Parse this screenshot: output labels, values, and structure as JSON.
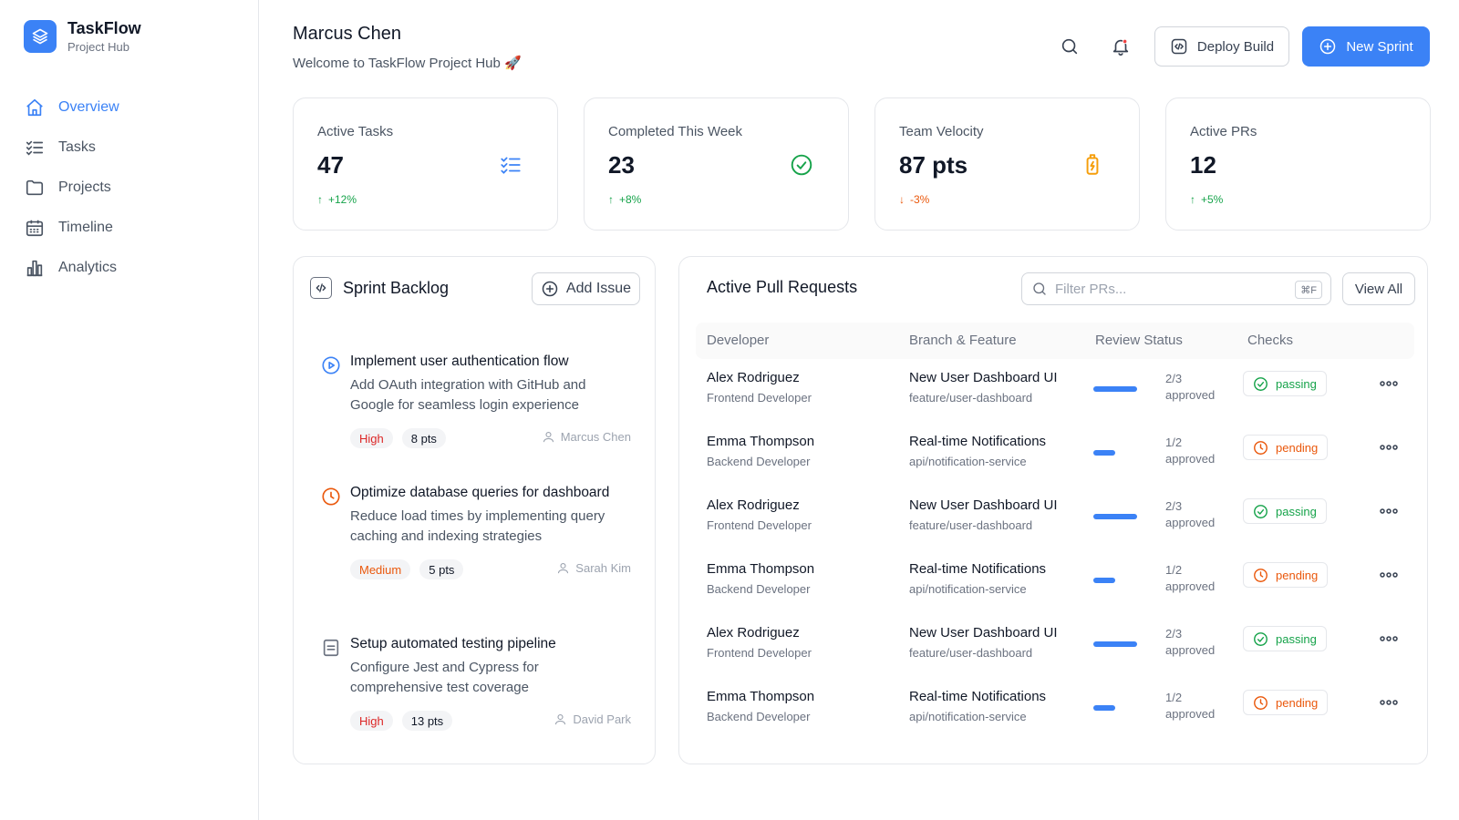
{
  "sidebar": {
    "brand_name": "TaskFlow",
    "brand_sub": "Project Hub",
    "items": [
      {
        "label": "Overview",
        "icon": "home-icon",
        "active": true
      },
      {
        "label": "Tasks",
        "icon": "list-check-icon"
      },
      {
        "label": "Projects",
        "icon": "folder-icon"
      },
      {
        "label": "Timeline",
        "icon": "calendar-icon"
      },
      {
        "label": "Analytics",
        "icon": "bar-chart-icon"
      }
    ]
  },
  "header": {
    "user_name": "Marcus Chen",
    "welcome": "Welcome to TaskFlow Project Hub 🚀",
    "deploy_label": "Deploy Build",
    "new_sprint_label": "New Sprint"
  },
  "stats": [
    {
      "label": "Active Tasks",
      "value": "47",
      "trend": "+12%",
      "direction": "up",
      "icon": "list-check-icon"
    },
    {
      "label": "Completed This Week",
      "value": "23",
      "trend": "+8%",
      "direction": "up",
      "icon": "check-circle-icon"
    },
    {
      "label": "Team Velocity",
      "value": "87 pts",
      "trend": "-3%",
      "direction": "down",
      "icon": "battery-charging-icon"
    },
    {
      "label": "Active PRs",
      "value": "12",
      "trend": "+5%",
      "direction": "up",
      "icon": ""
    }
  ],
  "backlog": {
    "title": "Sprint Backlog",
    "add_label": "Add Issue",
    "tasks": [
      {
        "title": "Implement user authentication flow",
        "desc": "Add OAuth integration with GitHub and Google for seamless login experience",
        "priority": "High",
        "points": "8 pts",
        "assignee": "Marcus Chen",
        "status": "play-circle-icon"
      },
      {
        "title": "Optimize database queries for dashboard",
        "desc": "Reduce load times by implementing query caching and indexing strategies",
        "priority": "Medium",
        "points": "5 pts",
        "assignee": "Sarah Kim",
        "status": "clock-icon"
      },
      {
        "title": "Setup automated testing pipeline",
        "desc": "Configure Jest and Cypress for comprehensive test coverage",
        "priority": "High",
        "points": "13 pts",
        "assignee": "David Park",
        "status": "document-icon"
      }
    ]
  },
  "prs": {
    "title": "Active Pull Requests",
    "filter_placeholder": "Filter PRs...",
    "shortcut": "⌘F",
    "view_all_label": "View All",
    "columns": [
      "Developer",
      "Branch & Feature",
      "Review Status",
      "Checks"
    ],
    "rows": [
      {
        "dev": "Alex Rodriguez",
        "role": "Frontend Developer",
        "feature": "New User Dashboard UI",
        "branch": "feature/user-dashboard",
        "review_frac": "2/3",
        "review_word": "approved",
        "review_ratio": 0.667,
        "check": "passing"
      },
      {
        "dev": "Emma Thompson",
        "role": "Backend Developer",
        "feature": "Real-time Notifications",
        "branch": "api/notification-service",
        "review_frac": "1/2",
        "review_word": "approved",
        "review_ratio": 0.5,
        "check": "pending"
      },
      {
        "dev": "Alex Rodriguez",
        "role": "Frontend Developer",
        "feature": "New User Dashboard UI",
        "branch": "feature/user-dashboard",
        "review_frac": "2/3",
        "review_word": "approved",
        "review_ratio": 0.667,
        "check": "passing"
      },
      {
        "dev": "Emma Thompson",
        "role": "Backend Developer",
        "feature": "Real-time Notifications",
        "branch": "api/notification-service",
        "review_frac": "1/2",
        "review_word": "approved",
        "review_ratio": 0.5,
        "check": "pending"
      },
      {
        "dev": "Alex Rodriguez",
        "role": "Frontend Developer",
        "feature": "New User Dashboard UI",
        "branch": "feature/user-dashboard",
        "review_frac": "2/3",
        "review_word": "approved",
        "review_ratio": 0.667,
        "check": "passing"
      },
      {
        "dev": "Emma Thompson",
        "role": "Backend Developer",
        "feature": "Real-time Notifications",
        "branch": "api/notification-service",
        "review_frac": "1/2",
        "review_word": "approved",
        "review_ratio": 0.5,
        "check": "pending"
      }
    ]
  },
  "colors": {
    "accent": "#3b82f6",
    "success": "#16a34a",
    "warning": "#ea580c",
    "danger": "#dc2626"
  }
}
